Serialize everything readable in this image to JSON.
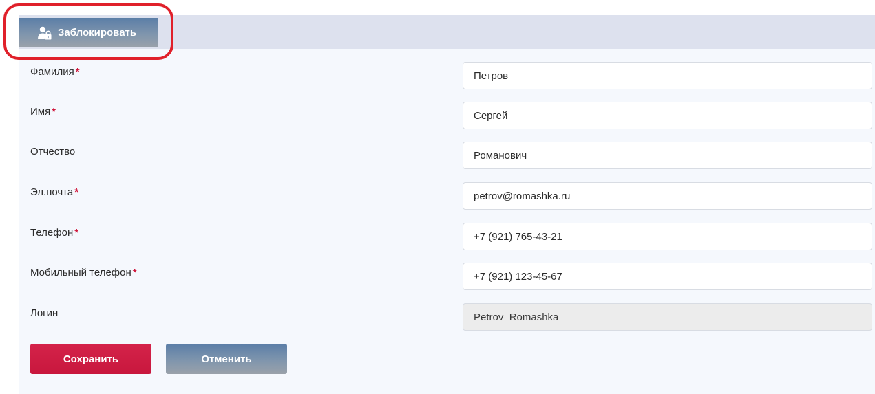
{
  "toolbar": {
    "block_label": "Заблокировать",
    "block_icon": "user-lock-icon"
  },
  "form": {
    "fields": [
      {
        "label": "Фамилия",
        "required": "*",
        "value": "Петров"
      },
      {
        "label": "Имя",
        "required": "*",
        "value": "Сергей"
      },
      {
        "label": "Отчество",
        "required": "",
        "value": "Романович"
      },
      {
        "label": "Эл.почта",
        "required": "*",
        "value": "petrov@romashka.ru"
      },
      {
        "label": "Телефон",
        "required": "*",
        "value": "+7 (921) 765-43-21"
      },
      {
        "label": "Мобильный телефон",
        "required": "*",
        "value": "+7 (921) 123-45-67"
      },
      {
        "label": "Логин",
        "required": "",
        "value": "Petrov_Romashka"
      }
    ]
  },
  "actions": {
    "save_label": "Сохранить",
    "cancel_label": "Отменить"
  },
  "colors": {
    "required_star": "#d0183c",
    "save_button": "#c8173d",
    "cancel_button": "#6f89a8",
    "highlight": "#e0202a"
  }
}
